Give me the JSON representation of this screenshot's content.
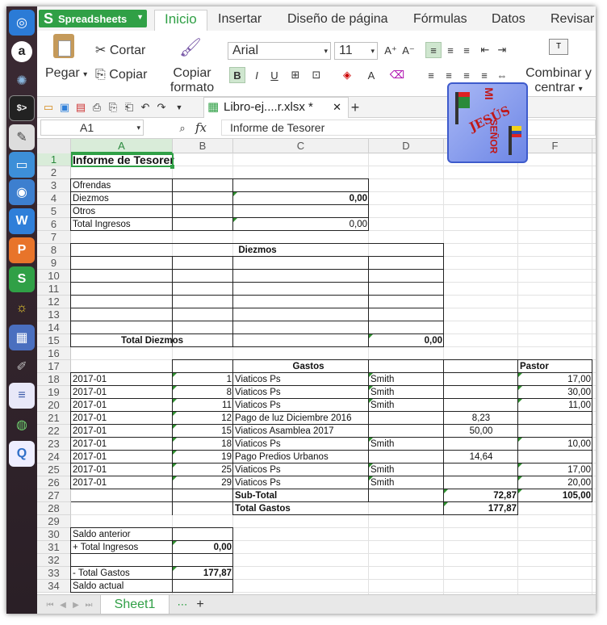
{
  "app": {
    "name": "Spreadsheets"
  },
  "tabs": [
    "Inicio",
    "Insertar",
    "Diseño de página",
    "Fórmulas",
    "Datos",
    "Revisar"
  ],
  "ribbon": {
    "paste": "Pegar",
    "cut": "Cortar",
    "copy": "Copiar",
    "copy_format_1": "Copiar",
    "copy_format_2": "formato",
    "font": "Arial",
    "size": "11",
    "merge_1": "Combinar y",
    "merge_2": "centrar"
  },
  "document": {
    "tab_title": "Libro-ej....r.xlsx *"
  },
  "formula": {
    "cell_ref": "A1",
    "fx": "fx",
    "content": "Informe de Tesorer"
  },
  "columns": [
    "A",
    "B",
    "C",
    "D",
    "E",
    "F"
  ],
  "rows": [
    "1",
    "2",
    "3",
    "4",
    "5",
    "6",
    "7",
    "8",
    "9",
    "10",
    "11",
    "12",
    "13",
    "14",
    "15",
    "16",
    "17",
    "18",
    "19",
    "20",
    "21",
    "22",
    "23",
    "24",
    "25",
    "26",
    "27",
    "28",
    "29",
    "30",
    "31",
    "32",
    "33",
    "34"
  ],
  "cells": {
    "title": "Informe de Tesorer",
    "ofrendas": "Ofrendas",
    "diezmos": "Diezmos",
    "otros": "Otros",
    "total_ingresos": "Total Ingresos",
    "diezmos_val": "0,00",
    "total_ingresos_val": "0,00",
    "diezmos_header": "Diezmos",
    "total_diezmos": "Total Diezmos",
    "total_diezmos_val": "0,00",
    "gastos_header": "Gastos",
    "pastor_header": "Pastor",
    "subtotal": "Sub-Total",
    "subtotal_e": "72,87",
    "subtotal_f": "105,00",
    "total_gastos": "Total Gastos",
    "total_gastos_val": "177,87",
    "saldo_anterior": "Saldo anterior",
    "mas_total_ingresos": "+ Total Ingresos",
    "mas_total_ingresos_val": "0,00",
    "menos_total_gastos": "- Total Gastos",
    "menos_total_gastos_val": "177,87",
    "saldo_actual": "Saldo actual"
  },
  "gastos": [
    {
      "a": "2017-01",
      "b": "1",
      "c": "Viaticos Ps",
      "d": "Smith",
      "e": "",
      "f": "17,00"
    },
    {
      "a": "2017-01",
      "b": "8",
      "c": "Viaticos Ps",
      "d": "Smith",
      "e": "",
      "f": "30,00"
    },
    {
      "a": "2017-01",
      "b": "11",
      "c": "Viaticos Ps",
      "d": "Smith",
      "e": "",
      "f": "11,00"
    },
    {
      "a": "2017-01",
      "b": "12",
      "c": "Pago de luz Diciembre 2016",
      "d": "",
      "e": "8,23",
      "f": ""
    },
    {
      "a": "2017-01",
      "b": "15",
      "c": "Viaticos Asamblea 2017",
      "d": "",
      "e": "50,00",
      "f": ""
    },
    {
      "a": "2017-01",
      "b": "18",
      "c": "Viaticos Ps",
      "d": "Smith",
      "e": "",
      "f": "10,00"
    },
    {
      "a": "2017-01",
      "b": "19",
      "c": "Pago Predios Urbanos",
      "d": "",
      "e": "14,64",
      "f": ""
    },
    {
      "a": "2017-01",
      "b": "25",
      "c": "Viaticos Ps",
      "d": "Smith",
      "e": "",
      "f": "17,00"
    },
    {
      "a": "2017-01",
      "b": "29",
      "c": "Viaticos Ps",
      "d": "Smith",
      "e": "",
      "f": "20,00"
    }
  ],
  "logo": {
    "line1": "MI",
    "line2": "JESÚS",
    "line3": "SEÑOR"
  },
  "sheet": {
    "name": "Sheet1"
  },
  "colors": {
    "accent": "#30a046",
    "launcher": "#2f2228"
  }
}
